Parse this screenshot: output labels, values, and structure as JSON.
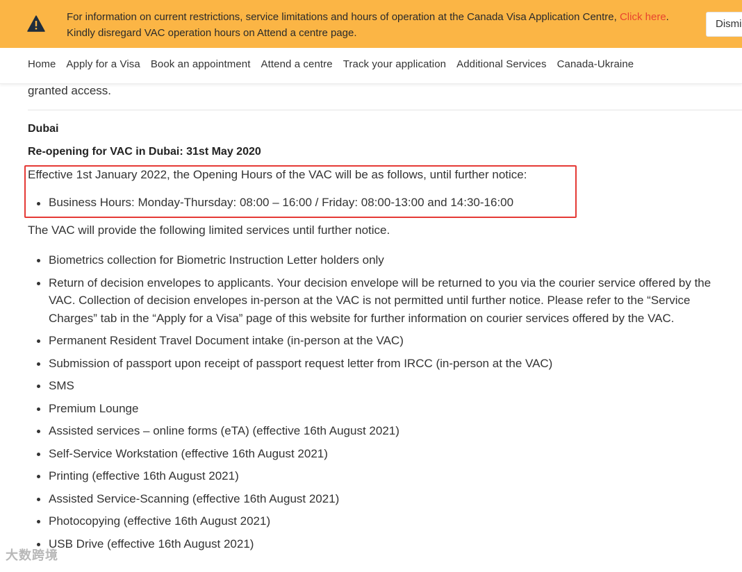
{
  "alert": {
    "icon": "warning-triangle-icon",
    "background": "#fbb545",
    "text_before": "For information on current restrictions, service limitations and hours of operation at the Canada Visa Application Centre, ",
    "link_text": "Click here",
    "text_after": ". Kindly disregard VAC operation hours on Attend a centre page.",
    "dismiss_label": "Dismi"
  },
  "nav": {
    "items": [
      {
        "label": "Home"
      },
      {
        "label": "Apply for a Visa"
      },
      {
        "label": "Book an appointment"
      },
      {
        "label": "Attend a centre"
      },
      {
        "label": "Track your application"
      },
      {
        "label": "Additional Services"
      },
      {
        "label": "Canada-Ukraine"
      }
    ]
  },
  "content": {
    "truncated_text": "granted access.",
    "city": "Dubai",
    "reopen": "Re-opening for VAC in Dubai: 31st May 2020",
    "effective": "Effective 1st January 2022, the Opening Hours of the VAC will be as follows, until further notice:",
    "hours": "Business Hours: Monday-Thursday: 08:00 – 16:00 / Friday: 08:00-13:00 and 14:30-16:00",
    "highlight_color": "#e53935",
    "limited_intro": "The VAC will provide the following limited services until further notice.",
    "services": [
      "Biometrics collection for Biometric Instruction Letter holders only",
      "Return of decision envelopes to applicants. Your decision envelope will be returned to you via the courier service offered by the VAC. Collection of decision envelopes in-person at the VAC is not permitted until further notice. Please refer to the “Service Charges” tab in the “Apply for a Visa” page of this website for further information on courier services offered by the VAC.",
      "Permanent Resident Travel Document intake (in-person at the VAC)",
      "Submission of passport upon receipt of passport request letter from IRCC (in-person at the VAC)",
      "SMS",
      "Premium Lounge",
      "Assisted services – online forms (eTA) (effective 16th August 2021)",
      "Self-Service Workstation (effective 16th August 2021)",
      "Printing (effective 16th August 2021)",
      "Assisted Service-Scanning (effective 16th August 2021)",
      "Photocopying (effective 16th August 2021)",
      "USB Drive (effective 16th August 2021)"
    ]
  },
  "watermark": "大数跨境"
}
